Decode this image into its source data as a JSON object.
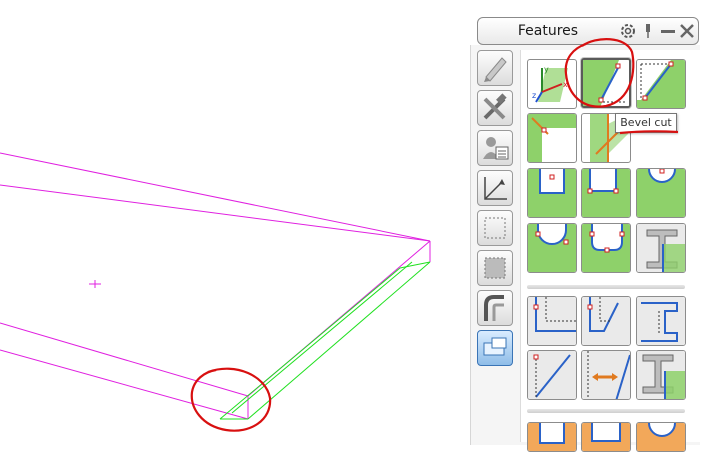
{
  "panel": {
    "title": "Features",
    "header_icons": [
      "gear-icon",
      "pin-icon",
      "minimize-icon",
      "close-icon"
    ]
  },
  "tooltip": {
    "text": "Bevel cut"
  },
  "categories": [
    {
      "name": "edit-tool",
      "active": false
    },
    {
      "name": "tools",
      "active": false
    },
    {
      "name": "properties",
      "active": false
    },
    {
      "name": "dimensions",
      "active": false
    },
    {
      "name": "boundary",
      "active": false
    },
    {
      "name": "profile",
      "active": false
    },
    {
      "name": "bend",
      "active": false
    },
    {
      "name": "features",
      "active": true
    }
  ],
  "feature_tiles": [
    {
      "name": "coordinate-system",
      "selected": false
    },
    {
      "name": "bevel-cut",
      "selected": true
    },
    {
      "name": "corner-bevel",
      "selected": false
    },
    {
      "name": "corner-cut-a",
      "selected": false
    },
    {
      "name": "corner-cut-b",
      "selected": false
    },
    {
      "name": "notch-rectangular",
      "selected": false
    },
    {
      "name": "notch-corner",
      "selected": false
    },
    {
      "name": "notch-round",
      "selected": false
    },
    {
      "name": "notch-round-corner",
      "selected": false
    },
    {
      "name": "notch-rounded-rect",
      "selected": false
    },
    {
      "name": "beam-cut",
      "selected": false
    },
    {
      "name": "edge-corner",
      "selected": false
    },
    {
      "name": "edge-angle",
      "selected": false
    },
    {
      "name": "edge-step",
      "selected": false
    },
    {
      "name": "edge-bevel",
      "selected": false
    },
    {
      "name": "edge-offset",
      "selected": false
    },
    {
      "name": "beam-notch",
      "selected": false
    }
  ],
  "colors": {
    "plate_outline": "#e020e0",
    "bevel_highlight": "#20e020",
    "annotation": "#d81010",
    "tile_green": "#8ed16a"
  }
}
